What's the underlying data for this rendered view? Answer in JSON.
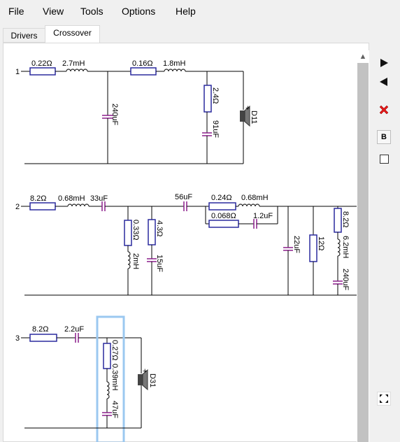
{
  "menu": [
    "File",
    "View",
    "Tools",
    "Options",
    "Help"
  ],
  "tabs": [
    "Drivers",
    "Crossover"
  ],
  "active_tab": "Crossover",
  "circuits": [
    {
      "number": "1",
      "r1": "0.22Ω",
      "l1": "2.7mH",
      "c_shunt": "240uF",
      "r2": "0.16Ω",
      "l2": "1.8mH",
      "r_parallel": "2.4Ω",
      "c_parallel": "91uF",
      "driver": "D11"
    },
    {
      "number": "2",
      "r1": "8.2Ω",
      "l1": "0.68mH",
      "c1": "33uF",
      "r_shunt1": "0.33Ω",
      "l_shunt1": "2mH",
      "r_shunt2": "4.3Ω",
      "c_shunt2": "15uF",
      "c2": "56uF",
      "r3": "0.24Ω",
      "l3": "0.68mH",
      "r_bypass": "0.068Ω",
      "c_bypass": "1.2uF",
      "c_shunt3": "22uF",
      "r_shunt3": "12Ω",
      "r_shunt4": "8.2Ω",
      "l_shunt4": "6.2mH",
      "c_shunt4": "240uF"
    },
    {
      "number": "3",
      "r1": "8.2Ω",
      "c1": "2.2uF",
      "r_shunt": "0.27Ω",
      "l_shunt": "0.39mH",
      "c_shunt": "47uF",
      "driver": "D31"
    }
  ],
  "side_buttons": {
    "next_icon": "play-right-icon",
    "prev_icon": "play-left-icon",
    "delete_icon": "red-x-icon",
    "b_label": "B",
    "fit_icon": "fit-arrows-icon"
  },
  "colors": {
    "resistor": "#2a2a9e",
    "inductor": "#222222",
    "capacitor": "#8a1d8a",
    "wire": "#000000",
    "selection": "#9bc8f0",
    "delete": "#e01818"
  }
}
